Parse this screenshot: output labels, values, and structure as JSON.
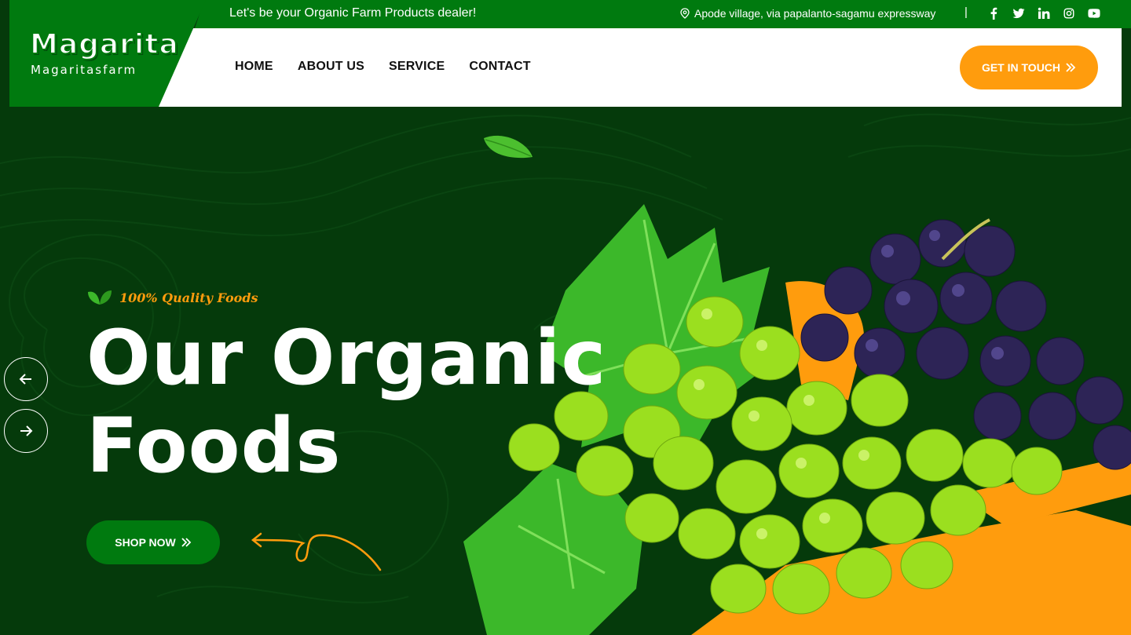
{
  "brand": {
    "name": "Magarita",
    "sub": "Magaritasfarm"
  },
  "topbar": {
    "slogan": "Let's be your Organic Farm Products dealer!",
    "address": "Apode village, via papalanto-sagamu expressway",
    "separator": "|",
    "socials": [
      "facebook-icon",
      "twitter-icon",
      "linkedin-icon",
      "instagram-icon",
      "youtube-icon"
    ]
  },
  "nav": {
    "items": [
      {
        "label": "HOME"
      },
      {
        "label": "ABOUT US"
      },
      {
        "label": "SERVICE"
      },
      {
        "label": "CONTACT"
      }
    ],
    "cta_label": "GET IN TOUCH"
  },
  "hero": {
    "tagline": "100% Quality Foods",
    "headline_line1": "Our Organic",
    "headline_line2": "Foods",
    "button_label": "SHOP NOW"
  },
  "colors": {
    "primary_green": "#007a0f",
    "hero_bg": "#053a0b",
    "accent_orange": "#ff9c0d",
    "white": "#ffffff"
  }
}
